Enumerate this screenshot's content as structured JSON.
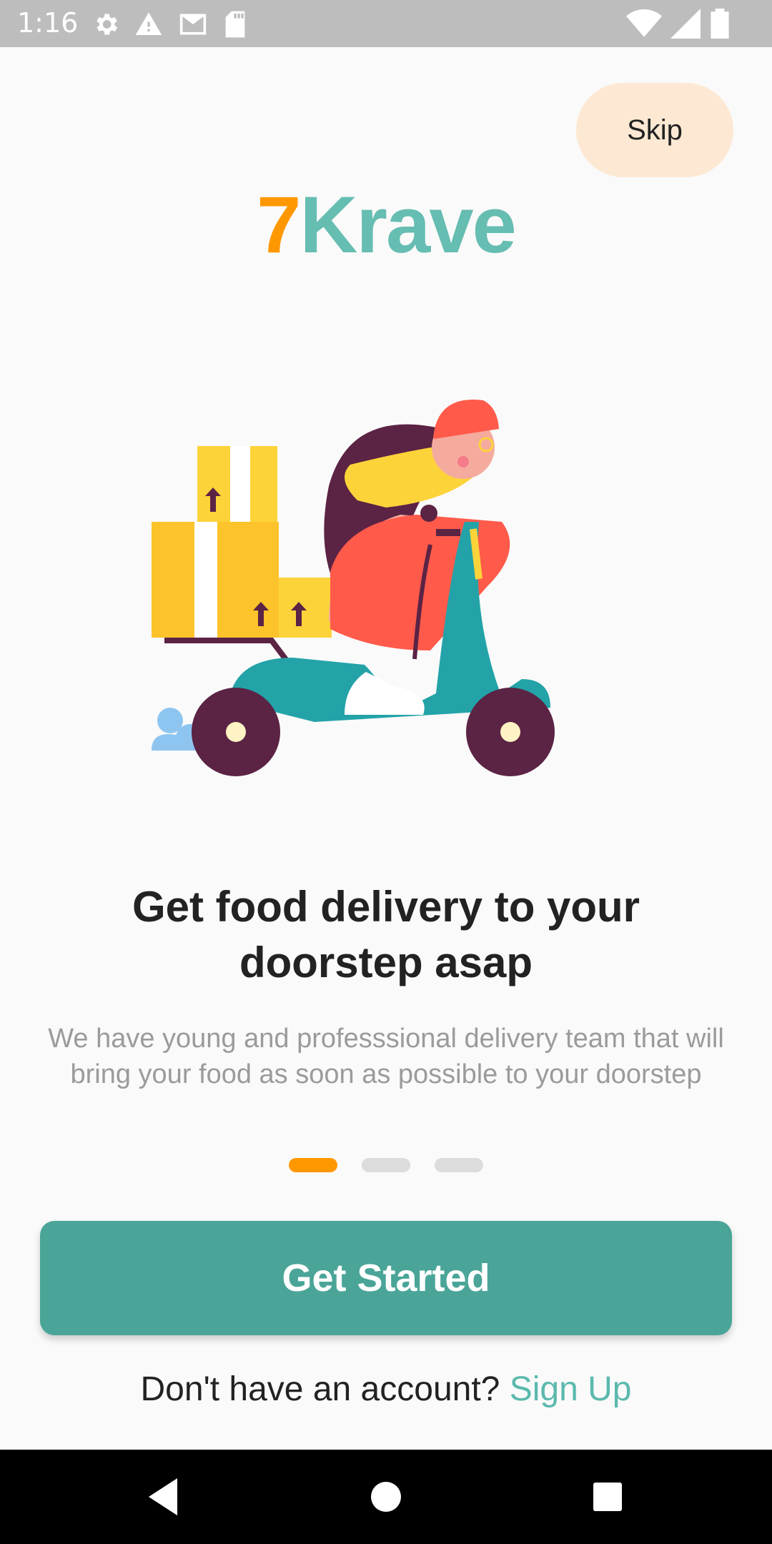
{
  "status_bar": {
    "time": "1:16",
    "left_icons": [
      "settings-icon",
      "warning-icon",
      "gmail-icon",
      "sd-card-icon"
    ],
    "right_icons": [
      "wifi-icon",
      "cell-signal-icon",
      "battery-icon"
    ]
  },
  "skip_label": "Skip",
  "logo": {
    "seven": "7",
    "name": "Krave"
  },
  "onboarding": {
    "headline": "Get food delivery to your doorstep asap",
    "subtitle": "We have young and professsional delivery team that will bring your food as soon as possible to your doorstep",
    "page_count": 3,
    "active_page": 1
  },
  "get_started_label": "Get Started",
  "signup": {
    "prompt": "Don't have an account?",
    "link": "Sign Up"
  },
  "nav_bar": {
    "icons": [
      "back-icon",
      "home-icon",
      "recents-icon"
    ]
  },
  "colors": {
    "accent_orange": "#ff9800",
    "brand_teal": "#66bdb2",
    "button_teal": "#4aa598",
    "skip_bg": "#fde9d3"
  }
}
